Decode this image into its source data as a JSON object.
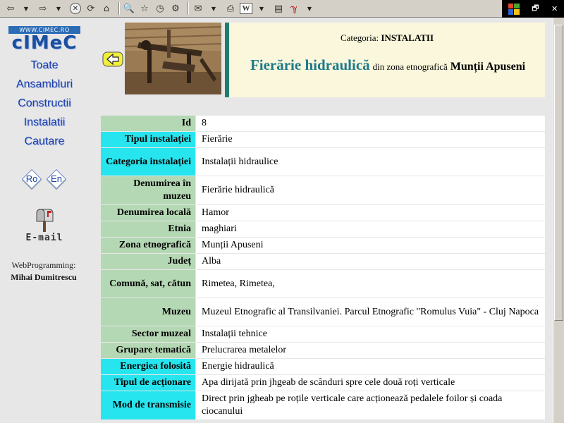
{
  "toolbar": {
    "icons": [
      "back-icon",
      "dropdown-icon",
      "forward-icon",
      "dropdown-icon",
      "stop-icon",
      "refresh-icon",
      "home-icon",
      "search-icon",
      "favorites-icon",
      "history-icon",
      "mail-icon",
      "print-icon",
      "edit-icon",
      "discuss-icon",
      "messenger-icon"
    ]
  },
  "sidebar": {
    "logo_url": "WWW.CIMEC.RO",
    "logo_text": "cIMeC",
    "nav": [
      "Toate",
      "Ansambluri",
      "Constructii",
      "Instalatii",
      "Cautare"
    ],
    "lang_ro": "Ro",
    "lang_en": "En",
    "email_label": "E-mail",
    "webprog_label": "WebProgramming:",
    "author_name": "Mihai Dumitrescu"
  },
  "header": {
    "category_prefix": "Categoria:",
    "category_value": "INSTALATII",
    "title": "Fierărie hidraulică",
    "title_mid": "din zona etnografică",
    "zone": "Munții Apuseni"
  },
  "table": {
    "rows": [
      {
        "label": "Id",
        "value": "8",
        "color": "green"
      },
      {
        "label": "Tipul instalației",
        "value": "Fierărie",
        "color": "cyan"
      },
      {
        "label": "Categoria instalației",
        "value": "Instalații hidraulice",
        "color": "cyan"
      },
      {
        "label": "Denumirea în muzeu",
        "value": "Fierărie hidraulică",
        "color": "green"
      },
      {
        "label": "Denumirea locală",
        "value": "Hamor",
        "color": "green"
      },
      {
        "label": "Etnia",
        "value": "maghiari",
        "color": "green"
      },
      {
        "label": "Zona etnografică",
        "value": "Munții Apuseni",
        "color": "green"
      },
      {
        "label": "Județ",
        "value": "Alba",
        "color": "green"
      },
      {
        "label": "Comună, sat, cătun",
        "value": "Rimetea, Rimetea,",
        "color": "green"
      },
      {
        "label": "Muzeu",
        "value": "Muzeul Etnografic al Transilvaniei. Parcul Etnografic \"Romulus Vuia\" - Cluj Napoca",
        "color": "green"
      },
      {
        "label": "Sector muzeal",
        "value": "Instalații tehnice",
        "color": "green"
      },
      {
        "label": "Grupare tematică",
        "value": "Prelucrarea metalelor",
        "color": "green"
      },
      {
        "label": "Energiea folosită",
        "value": "Energie hidraulică",
        "color": "cyan"
      },
      {
        "label": "Tipul de acționare",
        "value": "Apa dirijată prin jhgeab de scânduri spre cele două roți verticale",
        "color": "cyan"
      },
      {
        "label": "Mod de transmisie",
        "value": "Direct prin jgheab pe roțile verticale care acționează pedalele foilor și coada ciocanului",
        "color": "cyan"
      }
    ]
  },
  "colors": {
    "label_green": "#b5d8b4",
    "label_cyan": "#27e5ee",
    "title_teal": "#1d7a8a",
    "nav_blue": "#1b3fa8",
    "header_bg": "#fbf7dc"
  }
}
